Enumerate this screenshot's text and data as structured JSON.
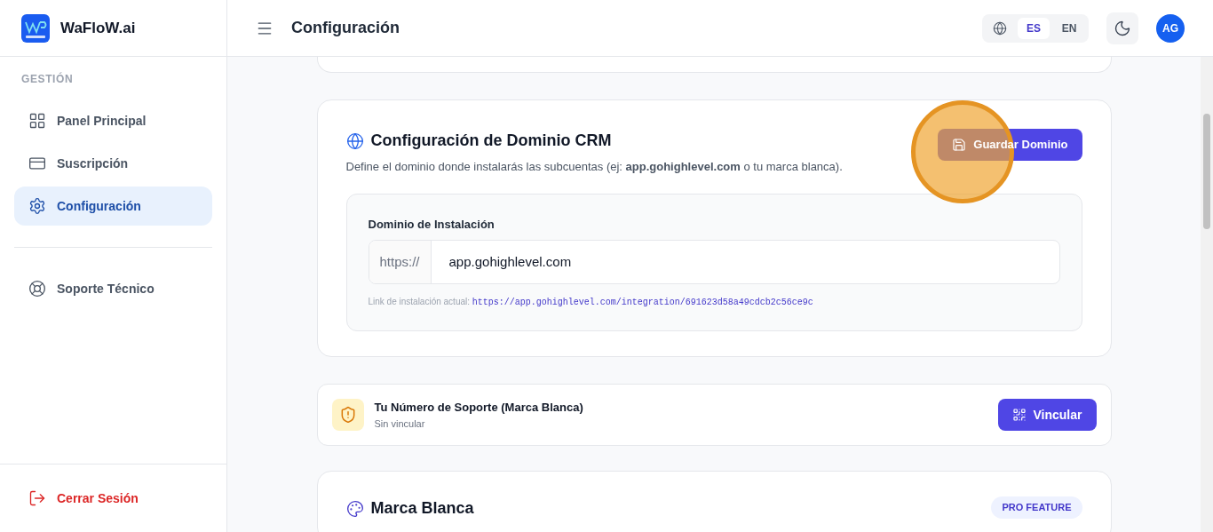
{
  "brand": {
    "name": "WaFloW.ai"
  },
  "sidebar": {
    "section": "GESTIÓN",
    "items": [
      {
        "kind": "grid",
        "label": "Panel Principal",
        "selected": false
      },
      {
        "kind": "card",
        "label": "Suscripción",
        "selected": false
      },
      {
        "kind": "gear",
        "label": "Configuración",
        "selected": true
      }
    ],
    "support": {
      "kind": "lifebuoy",
      "label": "Soporte Técnico",
      "selected": false
    },
    "logout": "Cerrar Sesión"
  },
  "header": {
    "title": "Configuración",
    "languages": [
      {
        "label": "ES",
        "selected": true
      },
      {
        "label": "EN",
        "selected": false
      }
    ],
    "avatar": "AG"
  },
  "domain_card": {
    "title": "Configuración de Dominio CRM",
    "description": "Define el dominio donde instalarás las subcuentas (ej: **app.gohighlevel.com** o tu marca blanca).",
    "save_button": "Guardar Dominio",
    "field_label": "Dominio de Instalación",
    "prefix": "https://",
    "value": "app.gohighlevel.com",
    "link_label": "Link de instalación actual:",
    "link": "https://app.gohighlevel.com/integration/691623d58a49cdcb2c56ce9c"
  },
  "support_card": {
    "title": "Tu Número de Soporte (Marca Blanca)",
    "status": "Sin vincular",
    "button": "Vincular"
  },
  "white_label_card": {
    "title": "Marca Blanca",
    "badge": "PRO FEATURE"
  },
  "click_marker": {
    "on": true
  }
}
